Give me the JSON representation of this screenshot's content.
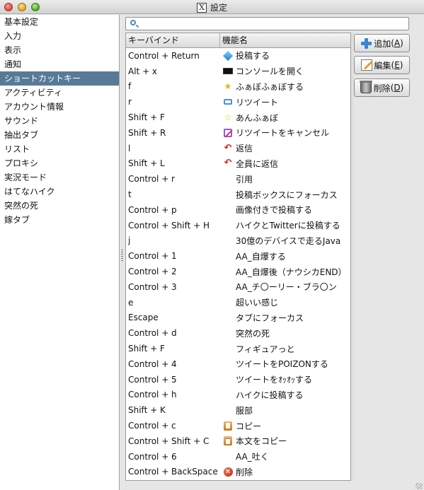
{
  "window": {
    "title": "設定"
  },
  "sidebar": {
    "items": [
      {
        "label": "基本設定"
      },
      {
        "label": "入力"
      },
      {
        "label": "表示"
      },
      {
        "label": "通知"
      },
      {
        "label": "ショートカットキー",
        "selected": true
      },
      {
        "label": "アクティビティ"
      },
      {
        "label": "アカウント情報"
      },
      {
        "label": "サウンド"
      },
      {
        "label": "抽出タブ"
      },
      {
        "label": "リスト"
      },
      {
        "label": "プロキシ"
      },
      {
        "label": "実況モード"
      },
      {
        "label": "はてなハイク"
      },
      {
        "label": "突然の死"
      },
      {
        "label": "嫁タブ"
      }
    ]
  },
  "search": {
    "value": "",
    "placeholder": ""
  },
  "table": {
    "headers": {
      "keybind": "キーバインド",
      "function": "機能名"
    },
    "rows": [
      {
        "key": "Control + Return",
        "func": "投稿する",
        "icon": "post-icon"
      },
      {
        "key": "Alt + x",
        "func": "コンソールを開く",
        "icon": "console-icon"
      },
      {
        "key": "f",
        "func": "ふぁぼふぁぼする",
        "icon": "favorite-star-icon"
      },
      {
        "key": "r",
        "func": "リツイート",
        "icon": "retweet-icon"
      },
      {
        "key": "Shift + F",
        "func": "あんふぁぼ",
        "icon": "unfavorite-star-icon"
      },
      {
        "key": "Shift + R",
        "func": "リツイートをキャンセル",
        "icon": "cancel-retweet-icon"
      },
      {
        "key": "l",
        "func": "返信",
        "icon": "reply-icon"
      },
      {
        "key": "Shift + L",
        "func": "全員に返信",
        "icon": "reply-all-icon"
      },
      {
        "key": "Control + r",
        "func": "引用",
        "icon": ""
      },
      {
        "key": "t",
        "func": "投稿ボックスにフォーカス",
        "icon": ""
      },
      {
        "key": "Control + p",
        "func": "画像付きで投稿する",
        "icon": ""
      },
      {
        "key": "Control + Shift + H",
        "func": "ハイクとTwitterに投稿する",
        "icon": ""
      },
      {
        "key": "j",
        "func": "30億のデバイスで走るJava",
        "icon": ""
      },
      {
        "key": "Control + 1",
        "func": "AA_自爆する",
        "icon": ""
      },
      {
        "key": "Control + 2",
        "func": "AA_自爆後（ナウシカEND）",
        "icon": ""
      },
      {
        "key": "Control + 3",
        "func": "AA_チ〇ーリー・ブラ〇ン",
        "icon": ""
      },
      {
        "key": "e",
        "func": "超いい感じ",
        "icon": ""
      },
      {
        "key": "Escape",
        "func": "タブにフォーカス",
        "icon": ""
      },
      {
        "key": "Control + d",
        "func": "突然の死",
        "icon": ""
      },
      {
        "key": "Shift + F",
        "func": "フィギュアっと",
        "icon": ""
      },
      {
        "key": "Control + 4",
        "func": "ツイートをPOIZONする",
        "icon": ""
      },
      {
        "key": "Control + 5",
        "func": "ツイートをｵｯｵｯする",
        "icon": ""
      },
      {
        "key": "Control + h",
        "func": "ハイクに投稿する",
        "icon": ""
      },
      {
        "key": "Shift + K",
        "func": "服部",
        "icon": ""
      },
      {
        "key": "Control + c",
        "func": "コピー",
        "icon": "copy-icon"
      },
      {
        "key": "Control + Shift + C",
        "func": "本文をコピー",
        "icon": "copy-body-icon"
      },
      {
        "key": "Control + 6",
        "func": "AA_吐く",
        "icon": ""
      },
      {
        "key": "Control + BackSpace",
        "func": "削除",
        "icon": "delete-icon"
      }
    ]
  },
  "buttons": {
    "add": {
      "label": "追加",
      "mnemonic_open": "(",
      "mnemonic": "A",
      "mnemonic_close": ")"
    },
    "edit": {
      "label": "編集",
      "mnemonic_open": "(",
      "mnemonic": "E",
      "mnemonic_close": ")"
    },
    "delete": {
      "label": "削除",
      "mnemonic_open": "(",
      "mnemonic": "D",
      "mnemonic_close": ")"
    }
  },
  "colors": {
    "selection": "#587a98",
    "accent_blue": "#3a86d4",
    "reply_red": "#d42020"
  }
}
